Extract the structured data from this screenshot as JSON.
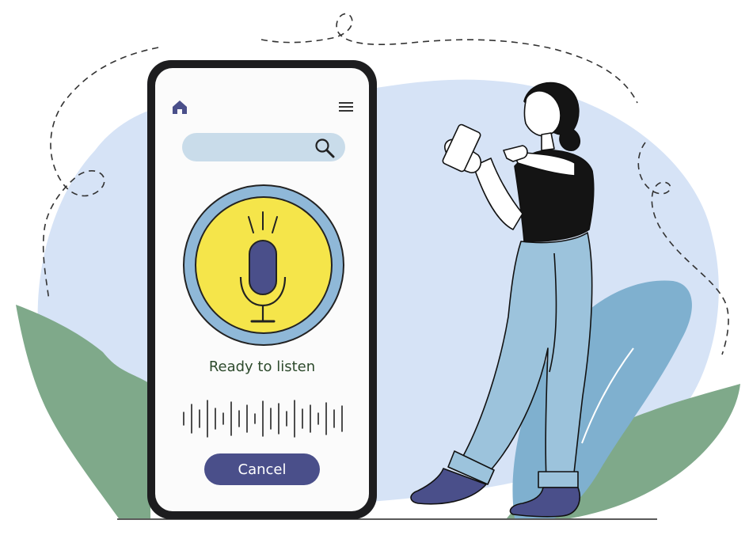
{
  "screen": {
    "status_text": "Ready to listen",
    "cancel_label": "Cancel",
    "icons": [
      "home-icon",
      "menu-icon",
      "search-icon",
      "microphone-icon"
    ]
  },
  "colors": {
    "accent": "#4a4f8a",
    "mic_yellow": "#f5e54a",
    "mic_ring": "#8fb8d8",
    "search_bg": "#c9dcea",
    "background_blob": "#d6e3f6",
    "leaves_green": "#7fa98a",
    "leaves_blue": "#7fb0cf"
  }
}
